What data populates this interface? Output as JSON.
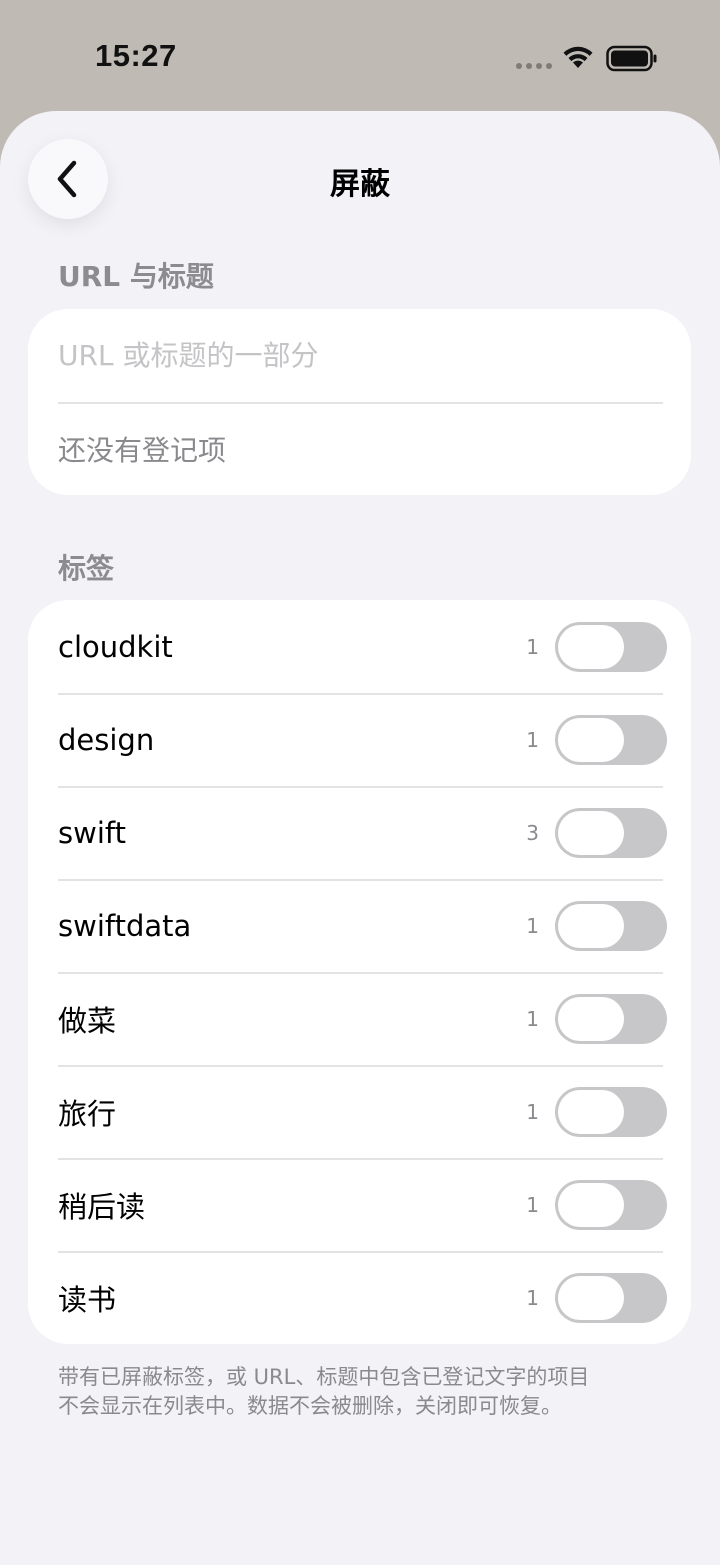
{
  "status_bar": {
    "time": "15:27"
  },
  "nav": {
    "title": "屏蔽",
    "back_icon": "chevron-left-icon"
  },
  "url_section": {
    "header": "URL 与标题",
    "input_placeholder": "URL 或标题的一部分",
    "input_value": "",
    "empty_text": "还没有登记项"
  },
  "tags_section": {
    "header": "标签",
    "items": [
      {
        "label": "cloudkit",
        "count": "1",
        "enabled": false
      },
      {
        "label": "design",
        "count": "1",
        "enabled": false
      },
      {
        "label": "swift",
        "count": "3",
        "enabled": false
      },
      {
        "label": "swiftdata",
        "count": "1",
        "enabled": false
      },
      {
        "label": "做菜",
        "count": "1",
        "enabled": false
      },
      {
        "label": "旅行",
        "count": "1",
        "enabled": false
      },
      {
        "label": "稍后读",
        "count": "1",
        "enabled": false
      },
      {
        "label": "读书",
        "count": "1",
        "enabled": false
      }
    ]
  },
  "footer": {
    "line1": "带有已屏蔽标签，或 URL、标题中包含已登记文字的项目",
    "line2": "不会显示在列表中。数据不会被删除，关闭即可恢复。"
  }
}
